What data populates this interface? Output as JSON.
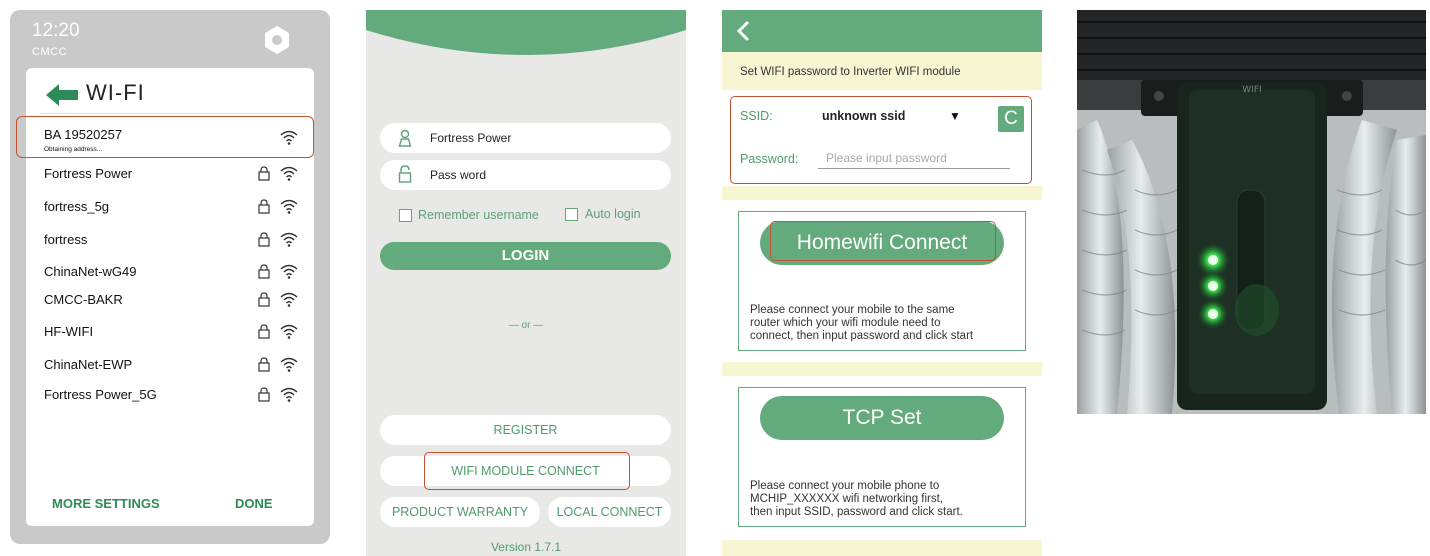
{
  "wifi_screen": {
    "time": "12:20",
    "carrier": "CMCC",
    "title": "WI-FI",
    "networks": [
      {
        "name": "BA 19520257",
        "status": "Obtaining address...",
        "locked": false
      },
      {
        "name": "Fortress Power",
        "status": "",
        "locked": true
      },
      {
        "name": "fortress_5g",
        "status": "",
        "locked": true
      },
      {
        "name": "fortress",
        "status": "",
        "locked": true
      },
      {
        "name": "ChinaNet-wG49",
        "status": "",
        "locked": true
      },
      {
        "name": "CMCC-BAKR",
        "status": "",
        "locked": true
      },
      {
        "name": "HF-WIFI",
        "status": "",
        "locked": true
      },
      {
        "name": "ChinaNet-EWP",
        "status": "",
        "locked": true
      },
      {
        "name": "Fortress Power_5G",
        "status": "",
        "locked": true
      }
    ],
    "more_settings": "MORE SETTINGS",
    "done": "DONE"
  },
  "login_screen": {
    "username": "Fortress Power",
    "password": "Pass word",
    "remember_username": "Remember username",
    "auto_login": "Auto login",
    "login_button": "LOGIN",
    "or_text": "— or —",
    "register": "REGISTER",
    "wifi_module_connect": "WIFI MODULE CONNECT",
    "product_warranty": "PRODUCT WARRANTY",
    "local_connect": "LOCAL CONNECT",
    "version": "Version 1.7.1"
  },
  "module_screen": {
    "instruction": "Set WIFI password to Inverter WIFI module",
    "ssid_label": "SSID:",
    "ssid_value": "unknown ssid",
    "password_label": "Password:",
    "password_placeholder": "Please input password",
    "homewifi_button": "Homewifi Connect",
    "homewifi_desc": [
      "Please connect your mobile to the same",
      "router which your wifi module need to",
      "connect, then input password and click start"
    ],
    "tcp_button": "TCP Set",
    "tcp_desc": [
      "Please connect your mobile phone to",
      "MCHIP_XXXXXX wifi networking first,",
      "then input SSID, password and click start."
    ]
  },
  "photo": {
    "module_label": "WIFI"
  },
  "colors": {
    "accent_green": "#63aa7c",
    "highlight_red": "#c2522f"
  }
}
